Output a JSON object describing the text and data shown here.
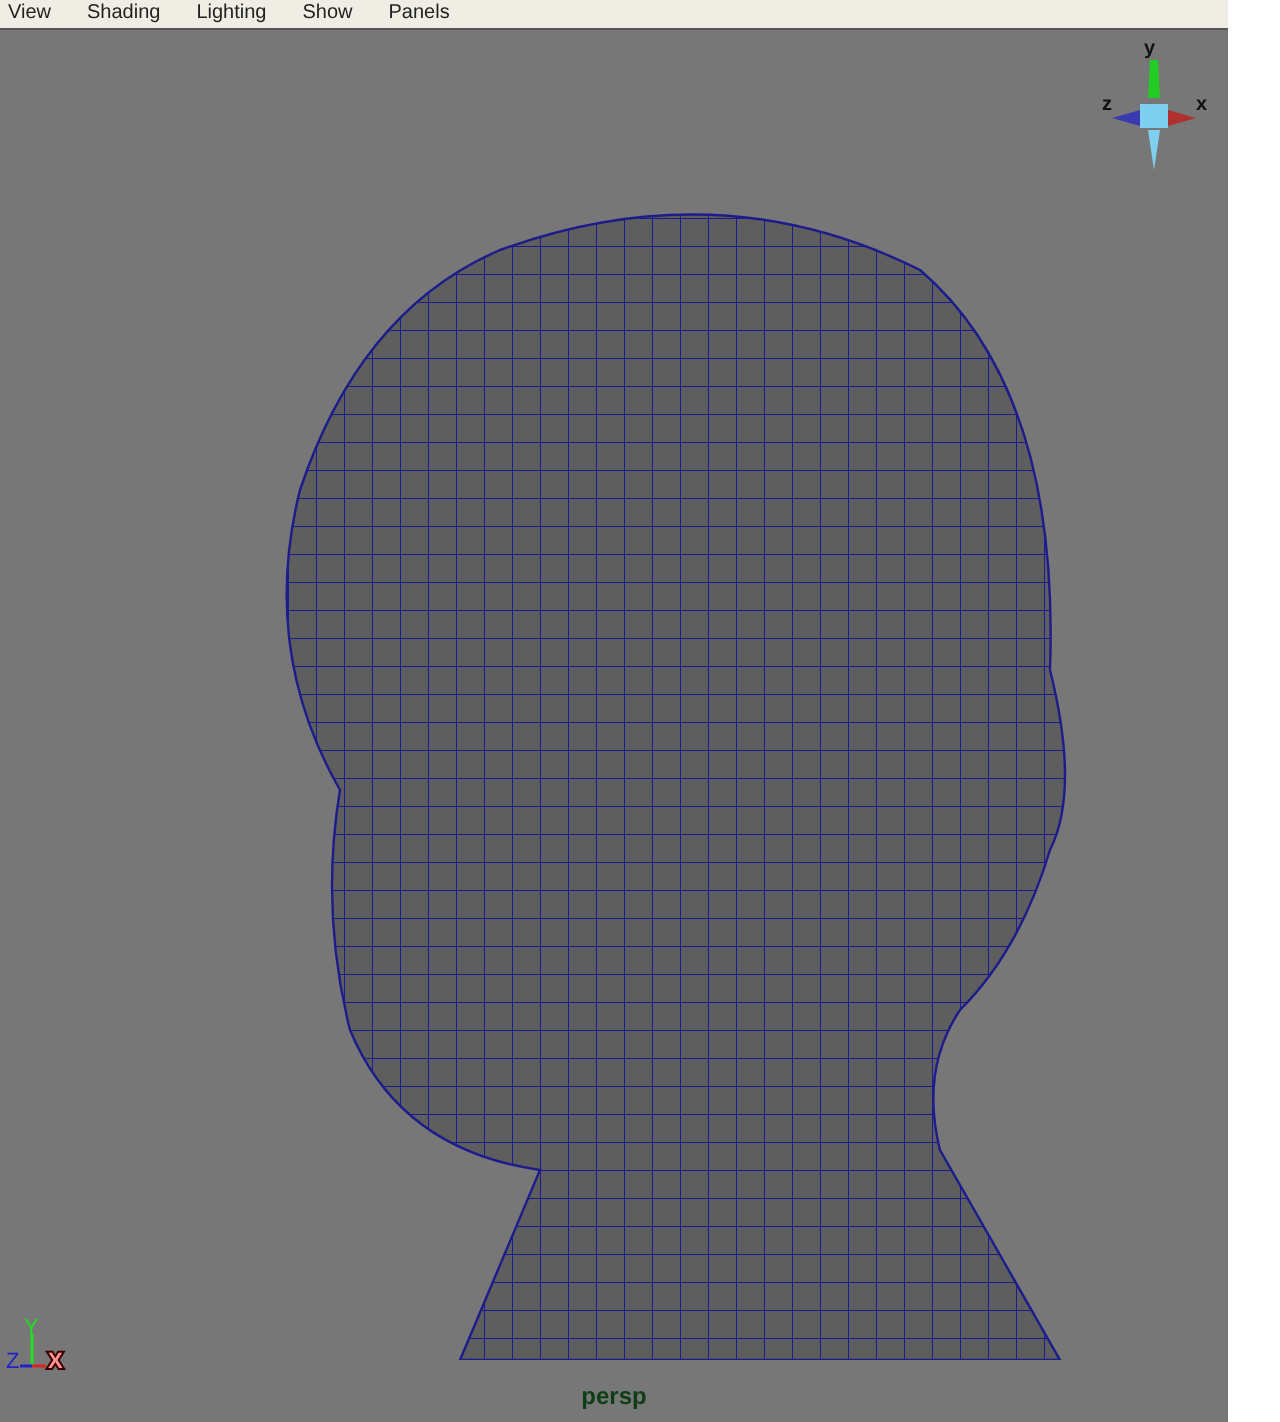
{
  "menu_bar": {
    "items": [
      "View",
      "Shading",
      "Lighting",
      "Show",
      "Panels"
    ]
  },
  "viewport": {
    "camera_label": "persp",
    "view_cube": {
      "axes": [
        "y",
        "z",
        "x"
      ]
    },
    "axis_indicator": {
      "axes": [
        "Y",
        "Z",
        "X"
      ]
    }
  }
}
